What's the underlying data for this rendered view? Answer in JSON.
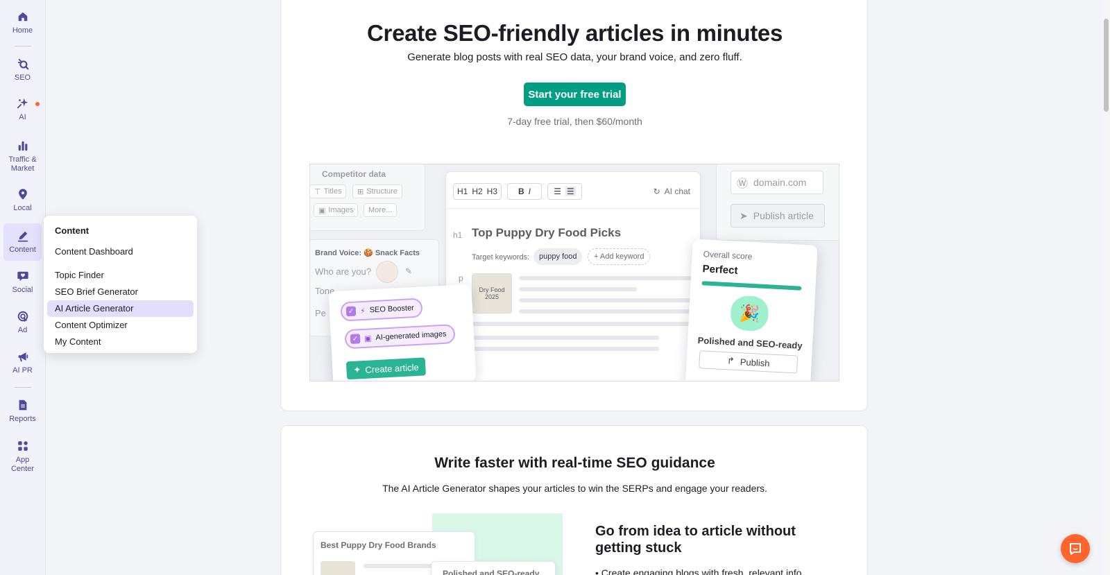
{
  "sidebar": {
    "items": [
      {
        "label": "Home",
        "icon": "home-icon"
      },
      {
        "label": "SEO",
        "icon": "seo-icon"
      },
      {
        "label": "AI",
        "icon": "ai-sparkle-icon"
      },
      {
        "label": "Traffic & Market",
        "icon": "bar-chart-icon"
      },
      {
        "label": "Local",
        "icon": "map-pin-icon"
      },
      {
        "label": "Content",
        "icon": "pen-icon"
      },
      {
        "label": "Social",
        "icon": "chat-heart-icon"
      },
      {
        "label": "Ad",
        "icon": "ad-target-icon"
      },
      {
        "label": "AI PR",
        "icon": "megaphone-icon"
      },
      {
        "label": "Reports",
        "icon": "report-icon"
      },
      {
        "label": "App Center",
        "icon": "apps-grid-icon"
      }
    ]
  },
  "flyout": {
    "title": "Content",
    "items": [
      "Content Dashboard",
      "Topic Finder",
      "SEO Brief Generator",
      "AI Article Generator",
      "Content Optimizer",
      "My Content"
    ],
    "selected": "AI Article Generator"
  },
  "hero": {
    "title": "Create SEO-friendly articles in minutes",
    "subtitle": "Generate blog posts with real SEO data, your brand voice, and zero fluff.",
    "cta": "Start your free trial",
    "trial_note": "7-day free trial, then $60/month"
  },
  "illustration": {
    "competitor_title": "Competitor data",
    "chips": [
      "Titles",
      "Structure",
      "Images",
      "More..."
    ],
    "brand_voice_title": "Brand Voice: 🍪 Snack Facts",
    "who_are_you": "Who are you?",
    "tone": "Tone",
    "pe": "Pe",
    "toolbar": {
      "h1": "H1",
      "h2": "H2",
      "h3": "H3",
      "bold": "B",
      "italic": "I",
      "ai_chat": "AI chat"
    },
    "h1_tag": "h1",
    "p_tag": "p",
    "article_title": "Top Puppy Dry Food Picks",
    "target_keywords_label": "Target keywords:",
    "keyword": "puppy food",
    "add_keyword": "+ Add keyword",
    "product_label": "Dry Food",
    "product_year": "2025",
    "domain_placeholder": "domain.com",
    "publish_article": "Publish article",
    "options": [
      "SEO Booster",
      "AI-generated images"
    ],
    "create_article": "Create article",
    "overall_score_label": "Overall score",
    "overall_score_value": "Perfect",
    "polished": "Polished and SEO-ready",
    "publish": "Publish"
  },
  "section2": {
    "title": "Write faster with real-time SEO guidance",
    "subtitle": "The AI Article Generator shapes your articles to win the SERPs and engage your readers.",
    "mock_title": "Best Puppy Dry Food Brands",
    "mock_badge": "Polished and SEO-ready",
    "heading": "Go from idea to article without getting stuck",
    "bullet": "Create engaging blogs with fresh, relevant info"
  },
  "colors": {
    "accent": "#009f81",
    "brand_orange": "#ff642d",
    "nav": "#4c4a9e"
  }
}
